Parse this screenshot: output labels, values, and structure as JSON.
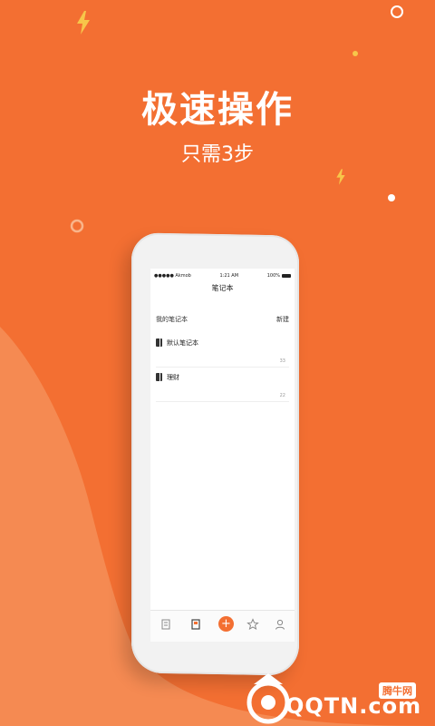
{
  "hero": {
    "title": "极速操作",
    "subtitle": "只需3步"
  },
  "colors": {
    "background": "#f36f32",
    "accent": "#f36f32",
    "bolt": "#f7c64a"
  },
  "phone": {
    "status": {
      "carrier": "Akmob",
      "time": "1:21 AM",
      "battery": "100%"
    },
    "nav_title": "笔记本",
    "section": {
      "label": "我的笔记本",
      "action": "新建"
    },
    "notebooks": [
      {
        "name": "默认笔记本",
        "count": "33"
      },
      {
        "name": "理财",
        "count": "22"
      }
    ],
    "tabbar": {
      "icons": [
        "note-icon",
        "notebook-icon",
        "add-icon",
        "star-icon",
        "user-icon"
      ],
      "add_label": "+"
    }
  },
  "watermark": {
    "text": "QQTN.com",
    "badge": "腾牛网"
  }
}
